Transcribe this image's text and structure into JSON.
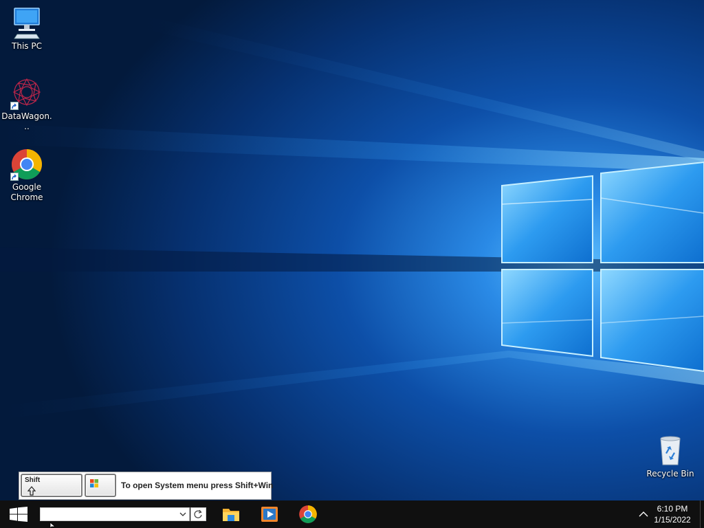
{
  "desktop": {
    "icons": [
      {
        "label": "This PC",
        "icon": "this-pc-icon"
      },
      {
        "label": "DataWagon...",
        "icon": "datawagon-icon",
        "shortcut": true
      },
      {
        "label": "Google Chrome",
        "icon": "chrome-icon",
        "shortcut": true
      },
      {
        "label": "Recycle Bin",
        "icon": "recycle-bin-icon"
      }
    ]
  },
  "hint": {
    "shift_key": "Shift",
    "text": "To open System menu press Shift+Win"
  },
  "taskbar": {
    "address_value": "",
    "apps": [
      {
        "name": "File Explorer",
        "icon": "file-explorer-icon"
      },
      {
        "name": "Media Player",
        "icon": "media-player-icon"
      },
      {
        "name": "Google Chrome",
        "icon": "chrome-icon"
      }
    ],
    "clock": {
      "time": "6:10 PM",
      "date": "1/15/2022"
    }
  },
  "colors": {
    "taskbar": "#101010",
    "wallpaper_dark": "#031a3c",
    "wallpaper_light": "#2f8fe0"
  }
}
